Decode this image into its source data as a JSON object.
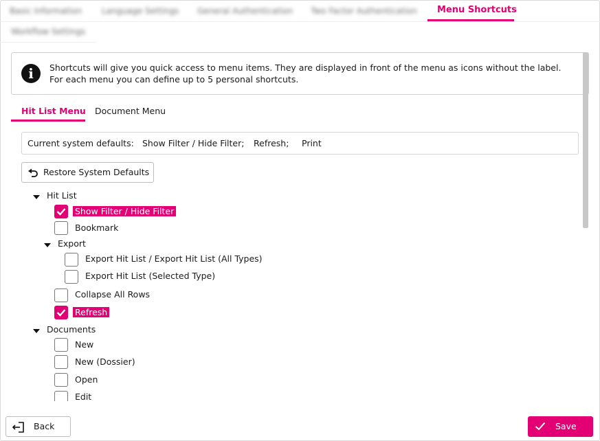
{
  "top_tabs": [
    {
      "label": "Basic Information",
      "active": false
    },
    {
      "label": "Language Settings",
      "active": false
    },
    {
      "label": "General Authentication",
      "active": false
    },
    {
      "label": "Two Factor Authentication",
      "active": false
    },
    {
      "label": "Menu Shortcuts",
      "active": true
    },
    {
      "label": "Workflow Settings",
      "active": false
    }
  ],
  "info": {
    "icon": "info-icon",
    "text": "Shortcuts will give you quick access to menu items. They are displayed in front of the menu as icons without the label. For each menu you can define up to 5 personal shortcuts."
  },
  "sub_tabs": [
    {
      "label": "Hit List Menu",
      "active": true
    },
    {
      "label": "Document Menu",
      "active": false
    }
  ],
  "defaults": {
    "label": "Current system defaults:",
    "items": [
      "Show Filter / Hide Filter;",
      "Refresh;",
      "Print"
    ]
  },
  "restore_button": {
    "label": "Restore System Defaults",
    "icon": "undo-icon"
  },
  "tree": {
    "hit_list": {
      "label": "Hit List",
      "items": [
        {
          "label": "Show Filter / Hide Filter",
          "checked": true
        },
        {
          "label": "Bookmark",
          "checked": false
        }
      ],
      "export": {
        "label": "Export",
        "items": [
          {
            "label": "Export Hit List / Export Hit List (All Types)",
            "checked": false
          },
          {
            "label": "Export Hit List (Selected Type)",
            "checked": false
          }
        ]
      },
      "items_after": [
        {
          "label": "Collapse All Rows",
          "checked": false
        },
        {
          "label": "Refresh",
          "checked": true
        }
      ]
    },
    "documents": {
      "label": "Documents",
      "items": [
        {
          "label": "New",
          "checked": false
        },
        {
          "label": "New (Dossier)",
          "checked": false
        },
        {
          "label": "Open",
          "checked": false
        },
        {
          "label": "Edit",
          "checked": false
        }
      ]
    }
  },
  "footer": {
    "back_label": "Back",
    "save_label": "Save"
  },
  "colors": {
    "accent": "#e20074",
    "text": "#1a1a1a",
    "border": "#d5d5d5"
  }
}
